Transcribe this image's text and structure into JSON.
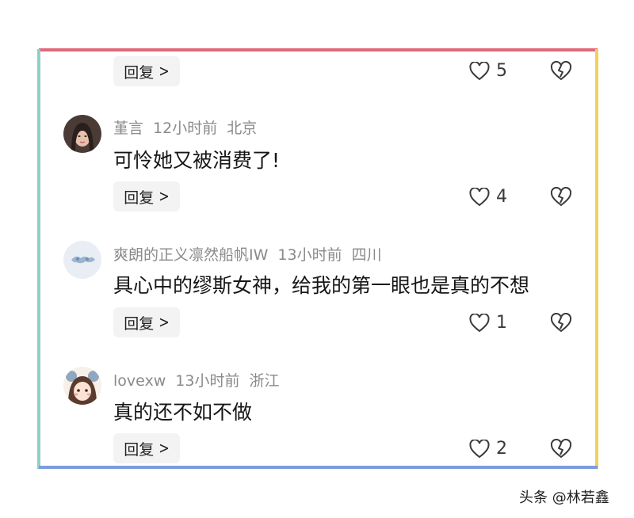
{
  "colors": {
    "frame_top": "#e2677a",
    "frame_left": "#8fcfc9",
    "frame_right": "#f2d05a",
    "frame_bottom": "#7f9bdc",
    "meta_text": "#8a8a8a",
    "reply_bg": "#f3f3f3"
  },
  "icons": {
    "like": "heart-outline-icon",
    "dislike": "broken-heart-icon",
    "reply_chevron": "chevron-right-icon"
  },
  "top_actions": {
    "reply_label": "回复",
    "like_count": "5"
  },
  "comments": [
    {
      "username": "堇言",
      "time": "12小时前",
      "location": "北京",
      "text": "可怜她又被消费了!",
      "reply_label": "回复",
      "like_count": "4"
    },
    {
      "username": "爽朗的正义凛然船帆IW",
      "time": "13小时前",
      "location": "四川",
      "text": "具心中的缪斯女神，给我的第一眼也是真的不想",
      "reply_label": "回复",
      "like_count": "1"
    },
    {
      "username": "lovexw",
      "time": "13小时前",
      "location": "浙江",
      "text": "真的还不如不做",
      "reply_label": "回复",
      "like_count": "2"
    }
  ],
  "watermark": "头条 @林若鑫"
}
